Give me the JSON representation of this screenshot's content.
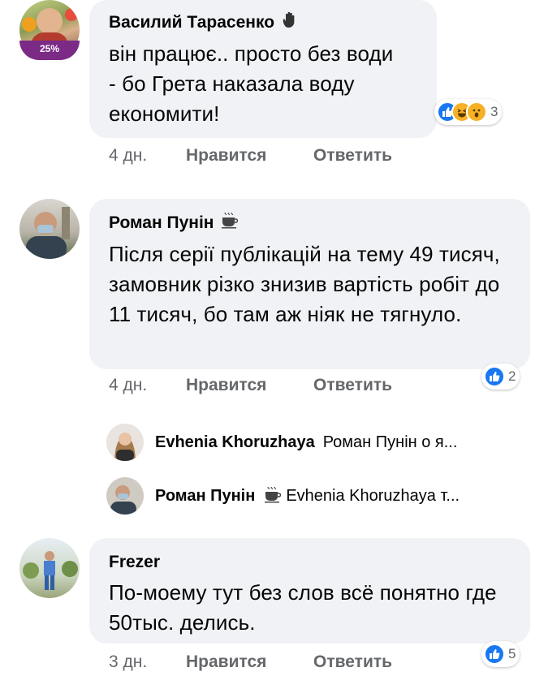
{
  "comments": [
    {
      "author": "Василий Тарасенко",
      "badge": "25%",
      "text": "він працює.. просто без води - бо Грета наказала воду економити!",
      "time": "4 дн.",
      "like": "Нравится",
      "reply": "Ответить",
      "reaction_count": "3"
    },
    {
      "author": "Роман Пунін",
      "text": "Після серії публікацій на тему 49 тисяч, замовник різко знизив вартість робіт до 11 тисяч, бо там аж ніяк не тягнуло.",
      "time": "4 дн.",
      "like": "Нравится",
      "reply": "Ответить",
      "reaction_count": "2"
    },
    {
      "author": "Frezer",
      "text": "По-моему тут без слов всё понятно где 50тыс. делись.",
      "time": "3 дн.",
      "like": "Нравится",
      "reply": "Ответить",
      "reaction_count": "5"
    }
  ],
  "replies": [
    {
      "author": "Evhenia Khoruzhaya",
      "preview": "Роман Пунін о я..."
    },
    {
      "author": "Роман Пунін",
      "preview": "Evhenia Khoruzhaya т..."
    }
  ],
  "colors": {
    "like_blue": "#1877f2",
    "haha_yellow": "#f7b125",
    "bubble": "#f0f2f5",
    "meta_gray": "#65676b"
  }
}
